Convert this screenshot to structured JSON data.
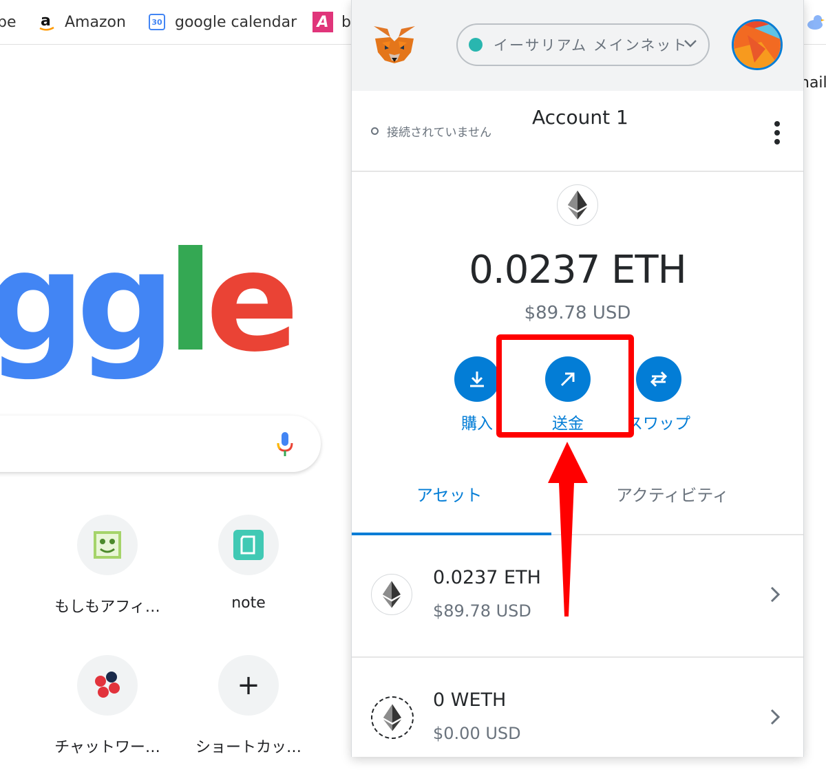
{
  "bookmarks": {
    "partial_left": "be",
    "items": [
      {
        "label": "Amazon",
        "icon": "amazon-icon"
      },
      {
        "label": "google calendar",
        "icon": "calendar-icon",
        "icon_text": "30"
      },
      {
        "label": "b",
        "icon": "a-bookmark-icon",
        "icon_text": "A"
      }
    ],
    "partial_right": "nail"
  },
  "google": {
    "logo_fragment": {
      "g": "g",
      "l": "l",
      "e": "e"
    },
    "shortcuts": [
      {
        "label": "もしもアフィ…",
        "icon": "moshimo-icon"
      },
      {
        "label": "note",
        "icon": "note-icon"
      },
      {
        "label": "チャットワー…",
        "icon": "chatwork-icon"
      },
      {
        "label": "ショートカッ…",
        "icon": "add-icon",
        "glyph": "+"
      }
    ]
  },
  "metamask": {
    "network": "イーサリアム メインネット",
    "connection_status": "接続されていません",
    "account_name": "Account 1",
    "balance": "0.0237 ETH",
    "balance_usd": "$89.78 USD",
    "actions": {
      "buy": "購入",
      "send": "送金",
      "swap": "スワップ"
    },
    "tabs": {
      "assets": "アセット",
      "activity": "アクティビティ"
    },
    "assets": [
      {
        "amount": "0.0237 ETH",
        "usd": "$89.78 USD",
        "icon": "eth-icon"
      },
      {
        "amount": "0 WETH",
        "usd": "$0.00 USD",
        "icon": "weth-icon"
      }
    ],
    "colors": {
      "accent": "#037dd6",
      "highlight": "#ff0000",
      "network_dot": "#29b6af"
    }
  }
}
